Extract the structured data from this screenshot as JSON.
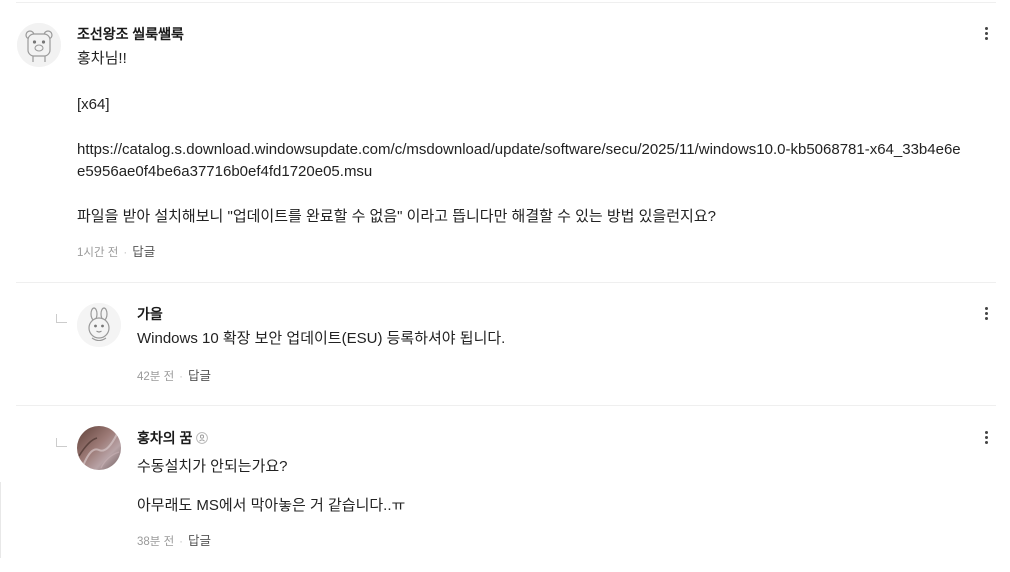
{
  "comments": [
    {
      "author": "조선왕조 씰룩쌜룩",
      "lines": [
        "홍차님!!",
        "[x64]",
        "https://catalog.s.download.windowsupdate.com/c/msdownload/update/software/secu/2025/11/windows10.0-kb5068781-x64_33b4e6e",
        "e5956ae0f4be6a37716b0ef4fd1720e05.msu",
        "파일을 받아 설치해보니 \"업데이트를 완료할 수 없음\" 이라고 뜹니다만 해결할 수 있는 방법 있을런지요?"
      ],
      "time": "1시간 전",
      "reply_label": "답글",
      "avatar_icon": "bear-avatar-icon"
    },
    {
      "author": "가을",
      "lines": [
        "Windows 10 확장 보안 업데이트(ESU) 등록하셔야 됩니다."
      ],
      "time": "42분 전",
      "reply_label": "답글",
      "avatar_icon": "rabbit-avatar-icon"
    },
    {
      "author": "홍차의 꿈",
      "lines": [
        "수동설치가 안되는가요?",
        "아무래도 MS에서 막아놓은 거 같습니다..ㅠ"
      ],
      "time": "38분 전",
      "reply_label": "답글",
      "avatar_icon": "photo-avatar-icon",
      "badge_icon": "author-badge-icon"
    }
  ],
  "colors": {
    "text": "#222222",
    "meta": "#9a9a9a",
    "divider": "#efefef",
    "icon": "#444444"
  }
}
